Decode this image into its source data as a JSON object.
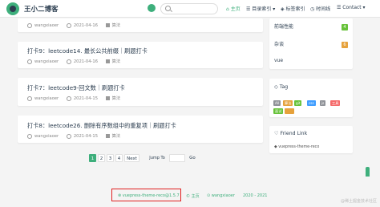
{
  "header": {
    "title": "王小二博客",
    "nav": [
      "主页",
      "目录索引",
      "标签索引",
      "时间线",
      "Contact"
    ]
  },
  "posts": [
    {
      "title": "",
      "author": "wangxiaoer",
      "date": "2021-04-16",
      "category": "算法"
    },
    {
      "title": "打卡9：leetcode14. 最长公共前缀｜刷题打卡",
      "author": "wangxiaoer",
      "date": "2021-04-16",
      "category": "算法"
    },
    {
      "title": "打卡7：leetcode9-回文数｜刷题打卡",
      "author": "wangxiaoer",
      "date": "2021-04-15",
      "category": "算法"
    },
    {
      "title": "打卡8：leetcode26. 删除有序数组中的重复项｜刷题打卡",
      "author": "wangxiaoer",
      "date": "2021-04-15",
      "category": "算法"
    }
  ],
  "pagination": {
    "pages": [
      "1",
      "2",
      "3",
      "4"
    ],
    "next": "Next",
    "jump_label": "Jump To",
    "go": "Go"
  },
  "sidebar": {
    "categories": [
      {
        "name": "前端性能",
        "count": "4",
        "color": "#67c23a"
      },
      {
        "name": "杂谈",
        "count": "6",
        "color": "#e6a23c"
      },
      {
        "name": "vue",
        "count": "",
        "color": "#909399"
      }
    ],
    "tag_title": "Tag",
    "tags": [
      {
        "label": "All",
        "color": "#909399"
      },
      {
        "label": "算法",
        "color": "#e6a23c"
      },
      {
        "label": "git",
        "color": "#67c23a"
      },
      {
        "label": "css",
        "color": "#409eff"
      },
      {
        "label": "js",
        "color": "#909399"
      },
      {
        "label": "工具",
        "color": "#f56c6c"
      },
      {
        "label": "面试",
        "color": "#67c23a"
      },
      {
        "label": "",
        "color": "#e6a23c"
      }
    ],
    "friend_title": "Friend Link",
    "friend_link": "vuepress-theme-reco"
  },
  "footer": {
    "theme": "vuepress-theme-reco@1.5.7",
    "home": "主页",
    "author": "wangxiaoer",
    "years": "2020 - 2021"
  },
  "watermark": "@稀土掘金技术社区"
}
